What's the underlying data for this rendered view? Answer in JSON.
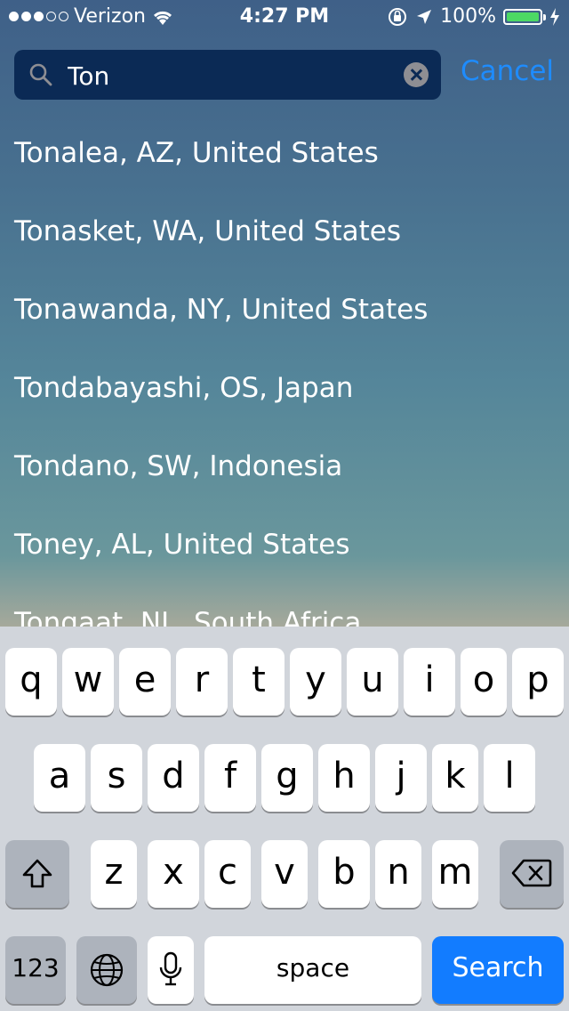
{
  "status_bar": {
    "carrier": "Verizon",
    "time": "4:27 PM",
    "battery_percent": "100%",
    "signal_bars_filled": 3,
    "signal_bars_total": 5
  },
  "search": {
    "value": "Ton",
    "cancel_label": "Cancel"
  },
  "results": [
    "Tonalea, AZ, United States",
    "Tonasket, WA, United States",
    "Tonawanda, NY, United States",
    "Tondabayashi, OS, Japan",
    "Tondano, SW, Indonesia",
    "Toney, AL, United States",
    "Tongaat, NL, South Africa"
  ],
  "keyboard": {
    "row1": [
      "q",
      "w",
      "e",
      "r",
      "t",
      "y",
      "u",
      "i",
      "o",
      "p"
    ],
    "row2": [
      "a",
      "s",
      "d",
      "f",
      "g",
      "h",
      "j",
      "k",
      "l"
    ],
    "row3": [
      "z",
      "x",
      "c",
      "v",
      "b",
      "n",
      "m"
    ],
    "numbers_label": "123",
    "space_label": "space",
    "search_label": "Search"
  },
  "colors": {
    "accent": "#1e8cff",
    "search_key": "#127cff",
    "battery": "#4cd964"
  }
}
